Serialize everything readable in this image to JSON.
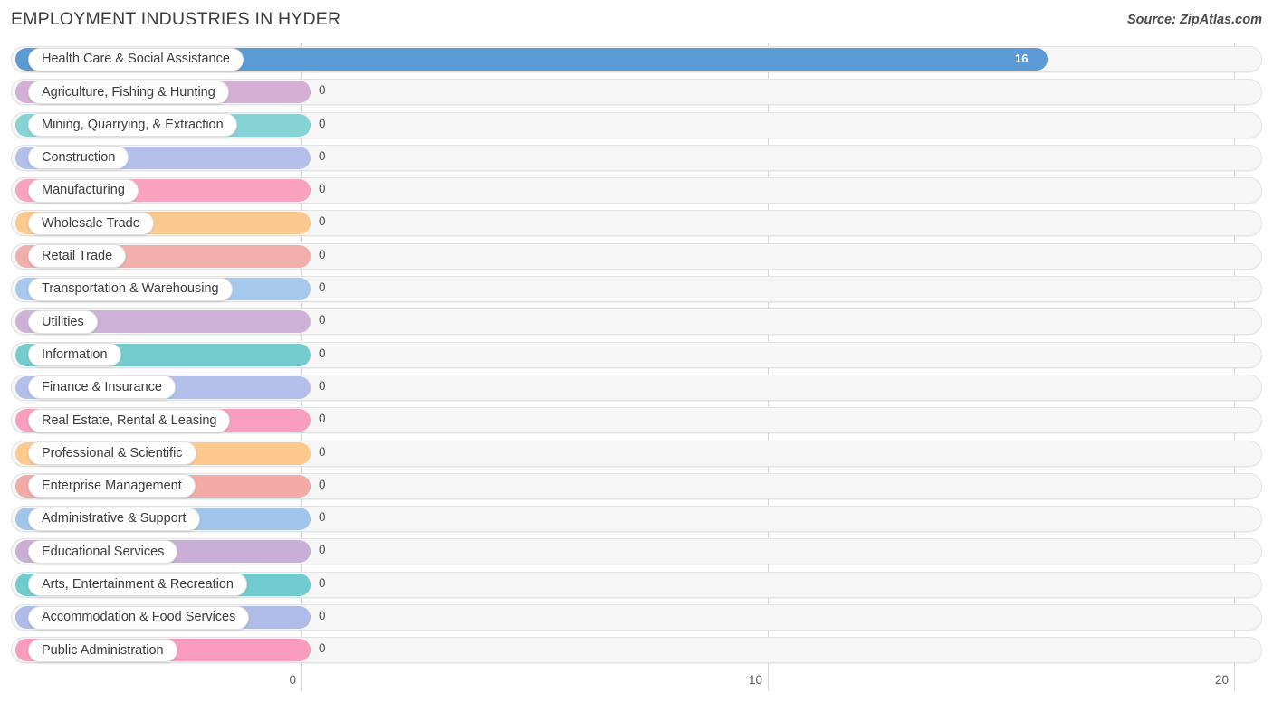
{
  "header": {
    "title": "EMPLOYMENT INDUSTRIES IN HYDER",
    "source": "Source: ZipAtlas.com"
  },
  "chart_data": {
    "type": "bar",
    "orientation": "horizontal",
    "title": "EMPLOYMENT INDUSTRIES IN HYDER",
    "xlabel": "",
    "ylabel": "",
    "xlim": [
      0,
      20
    ],
    "xticks": [
      0,
      10,
      20
    ],
    "xtick_labels": [
      "0",
      "10",
      "20"
    ],
    "grid": true,
    "legend": false,
    "categories": [
      "Health Care & Social Assistance",
      "Agriculture, Fishing & Hunting",
      "Mining, Quarrying, & Extraction",
      "Construction",
      "Manufacturing",
      "Wholesale Trade",
      "Retail Trade",
      "Transportation & Warehousing",
      "Utilities",
      "Information",
      "Finance & Insurance",
      "Real Estate, Rental & Leasing",
      "Professional & Scientific",
      "Enterprise Management",
      "Administrative & Support",
      "Educational Services",
      "Arts, Entertainment & Recreation",
      "Accommodation & Food Services",
      "Public Administration"
    ],
    "values": [
      16,
      0,
      0,
      0,
      0,
      0,
      0,
      0,
      0,
      0,
      0,
      0,
      0,
      0,
      0,
      0,
      0,
      0,
      0
    ],
    "value_labels": [
      "16",
      "0",
      "0",
      "0",
      "0",
      "0",
      "0",
      "0",
      "0",
      "0",
      "0",
      "0",
      "0",
      "0",
      "0",
      "0",
      "0",
      "0",
      "0"
    ],
    "colors": [
      "#5b9bd5",
      "#d4b0d6",
      "#86d3d6",
      "#b4c0ea",
      "#f9a3c1",
      "#fcca8e",
      "#f2aeaa",
      "#a5c8ec",
      "#cfb2d8",
      "#74ccce",
      "#b4bfea",
      "#fa9ec0",
      "#fdc98c",
      "#f2aba6",
      "#a2c6eb",
      "#c9aed5",
      "#6fcbcd",
      "#b0bce8",
      "#f99cbe"
    ]
  },
  "axis": {
    "ticks": [
      {
        "label": "0",
        "value": 0
      },
      {
        "label": "10",
        "value": 10
      },
      {
        "label": "20",
        "value": 20
      }
    ]
  },
  "style": {
    "track_bg": "#f6f6f6",
    "track_border": "#e3e3e3",
    "gridline": "#d8d8d8",
    "text": "#3a3a3a"
  }
}
